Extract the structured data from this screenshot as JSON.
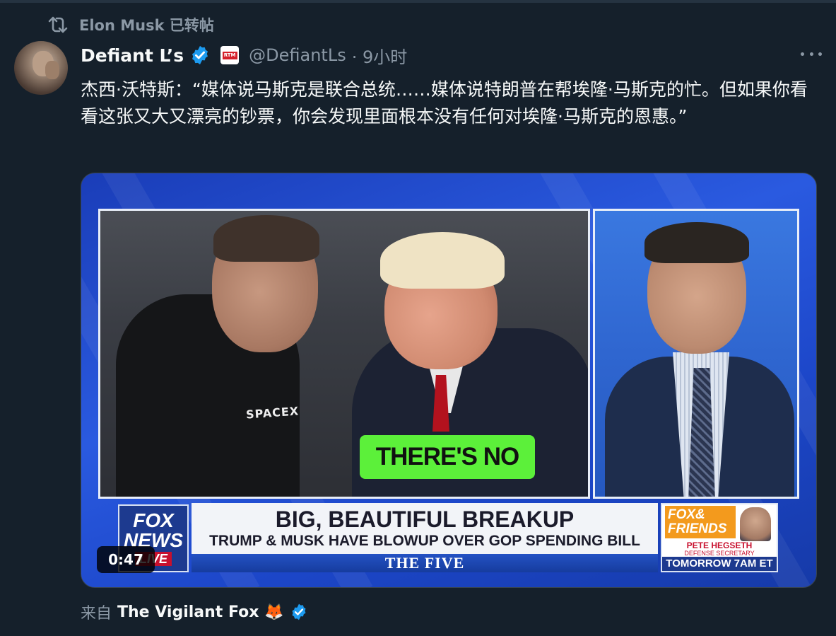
{
  "repost": {
    "icon": "repost-icon",
    "text": "Elon Musk 已转帖"
  },
  "author": {
    "name": "Defiant L’s",
    "verified_icon": "verified-badge-icon",
    "affiliate_badge": "RTM",
    "handle": "@DefiantLs",
    "time": " · 9小时"
  },
  "more_icon": "more-options-icon",
  "tweet": {
    "text": "杰西·沃特斯：“媒体说马斯克是联合总统……媒体说特朗普在帮埃隆·马斯克的忙。但如果你看看这张又大又漂亮的钞票，你会发现里面根本没有任何对埃隆·马斯克的恩惠。”"
  },
  "video": {
    "shirt_text": "SPACEX",
    "caption": "THERE'S NO",
    "lower_third": {
      "network_line1": "FOX",
      "network_line2": "NEWS",
      "live": "LIVE",
      "headline": "BIG, BEAUTIFUL BREAKUP",
      "subheadline": "TRUMP & MUSK HAVE BLOWUP OVER GOP SPENDING BILL",
      "show": "THE FIVE",
      "promo_show_line1": "FOX&",
      "promo_show_line2": "FRIENDS",
      "promo_guest": "PETE HEGSETH",
      "promo_guest_title": "DEFENSE SECRETARY",
      "promo_time": "TOMORROW 7AM ET"
    },
    "duration": "0:47",
    "colors": {
      "caption_bg": "#5cf03a",
      "background_blue": "#2a5ae0",
      "fox_red": "#c8102e",
      "promo_orange": "#f39a1d"
    }
  },
  "source": {
    "prefix": "来自",
    "name": "The Vigilant Fox",
    "emoji": "🦊",
    "verified_icon": "verified-badge-icon"
  }
}
